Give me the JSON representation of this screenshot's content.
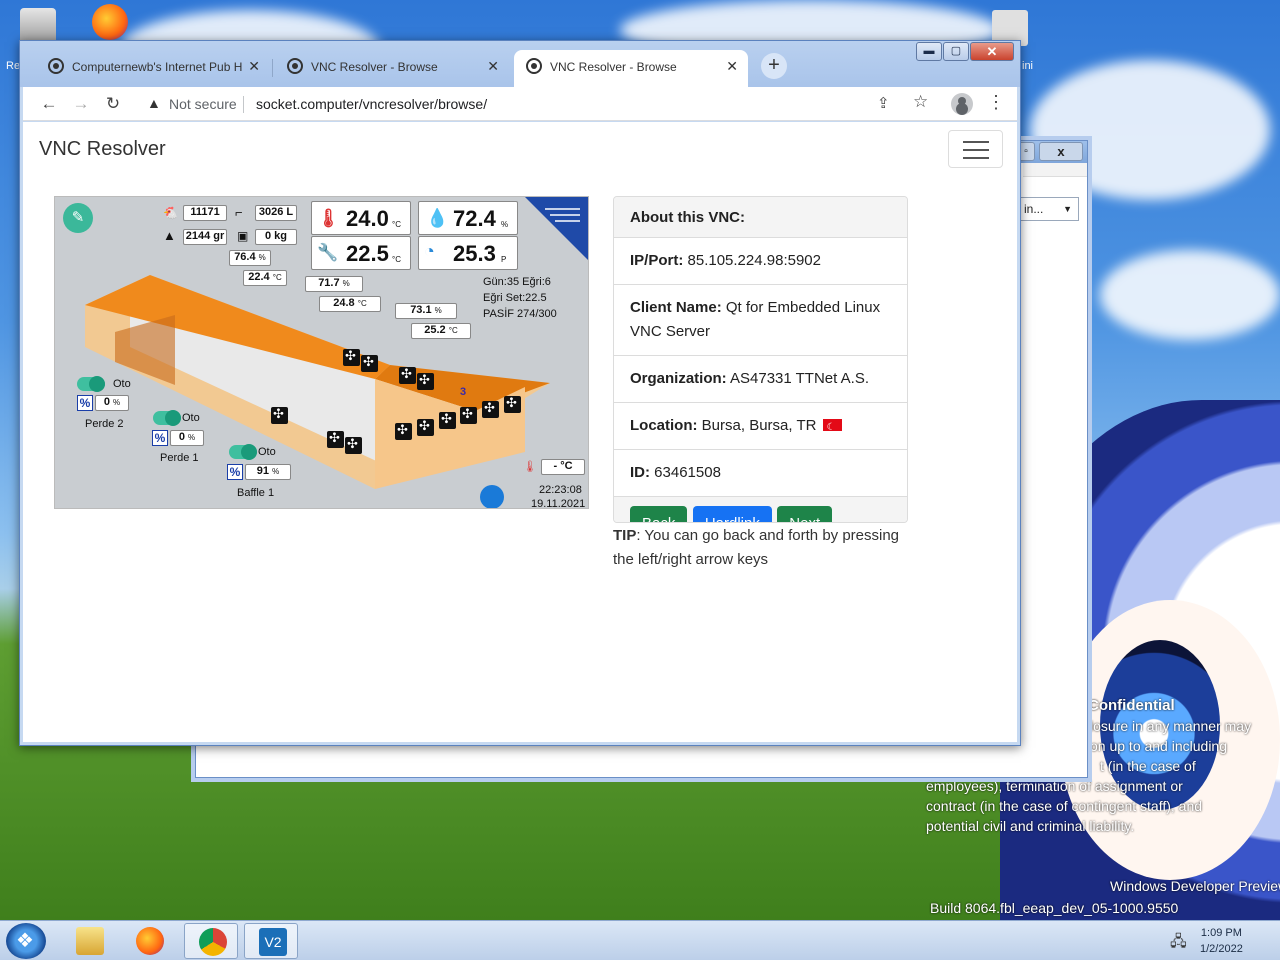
{
  "desktop": {
    "icon_left_label": "Re",
    "icon_right_label": "ini",
    "confidential_heading": "Confidential",
    "confidential_lines": [
      "losure in any manner may",
      "on up to and including",
      "t (in the case of",
      "employees), termination of assignment or",
      "contract (in the case of contingent staff), and",
      "potential civil and criminal liability."
    ],
    "watermark_line1": "Windows Developer Preview",
    "watermark_line2": "Build 8064.fbl_eeap_dev_05-1000.9550"
  },
  "back_window": {
    "close": "x",
    "field_text": "n in...",
    "right_label": ""
  },
  "browser": {
    "tabs": [
      {
        "label": "Computernewb's Internet Pub H"
      },
      {
        "label": "VNC Resolver - Browse"
      },
      {
        "label": "VNC Resolver - Browse"
      }
    ],
    "new_tab": "+",
    "security": "Not secure",
    "url": "socket.computer/vncresolver/browse/"
  },
  "page": {
    "brand": "VNC Resolver",
    "card": {
      "header": "About this VNC:",
      "ip_label": "IP/Port:",
      "ip_value": "85.105.224.98:5902",
      "client_label": "Client Name:",
      "client_value": "Qt for Embedded Linux VNC Server",
      "org_label": "Organization:",
      "org_value": "AS47331 TTNet A.S.",
      "loc_label": "Location:",
      "loc_value": "Bursa, Bursa, TR",
      "id_label": "ID:",
      "id_value": "63461508"
    },
    "buttons": {
      "back": "Back",
      "hardlink": "Hardlink",
      "next": "Next"
    },
    "tip_label": "TIP",
    "tip_text": ": You can go back and forth by pressing the left/right arrow keys"
  },
  "vnc": {
    "count1": "11171",
    "water_l": "3026 L",
    "feed_gr": "2144 gr",
    "weight": "0 kg",
    "hum1": "76.4",
    "temp_a": "22.4",
    "big_temp": "24.0",
    "big_temp_unit": "°C",
    "big_hum": "72.4",
    "big_hum_unit": "%",
    "big_set": "22.5",
    "big_set_unit": "°C",
    "big_press": "25.3",
    "big_press_unit": "P",
    "hum2": "71.7",
    "temp_b": "24.8",
    "hum3": "73.1",
    "temp_c": "25.2",
    "info1": "Gün:35 Eğri:6",
    "info2": "Eğri Set:22.5",
    "info3": "PASİF 274/300",
    "zone": "3",
    "oto": "Oto",
    "perde2_pct": "0",
    "perde2": "Perde 2",
    "perde1_pct": "0",
    "perde1": "Perde 1",
    "baffle_pct": "91",
    "baffle": "Baffle 1",
    "pct_unit": "%",
    "temp_unit": "°C",
    "out_temp": "- °C",
    "time": "22:23:08",
    "date": "19.11.2021"
  },
  "taskbar": {
    "time": "1:09 PM",
    "date": "1/2/2022"
  },
  "colors": {
    "green_btn": "#1e8449",
    "blue_btn": "#1672f3",
    "barn_orange": "#f08a1c"
  }
}
